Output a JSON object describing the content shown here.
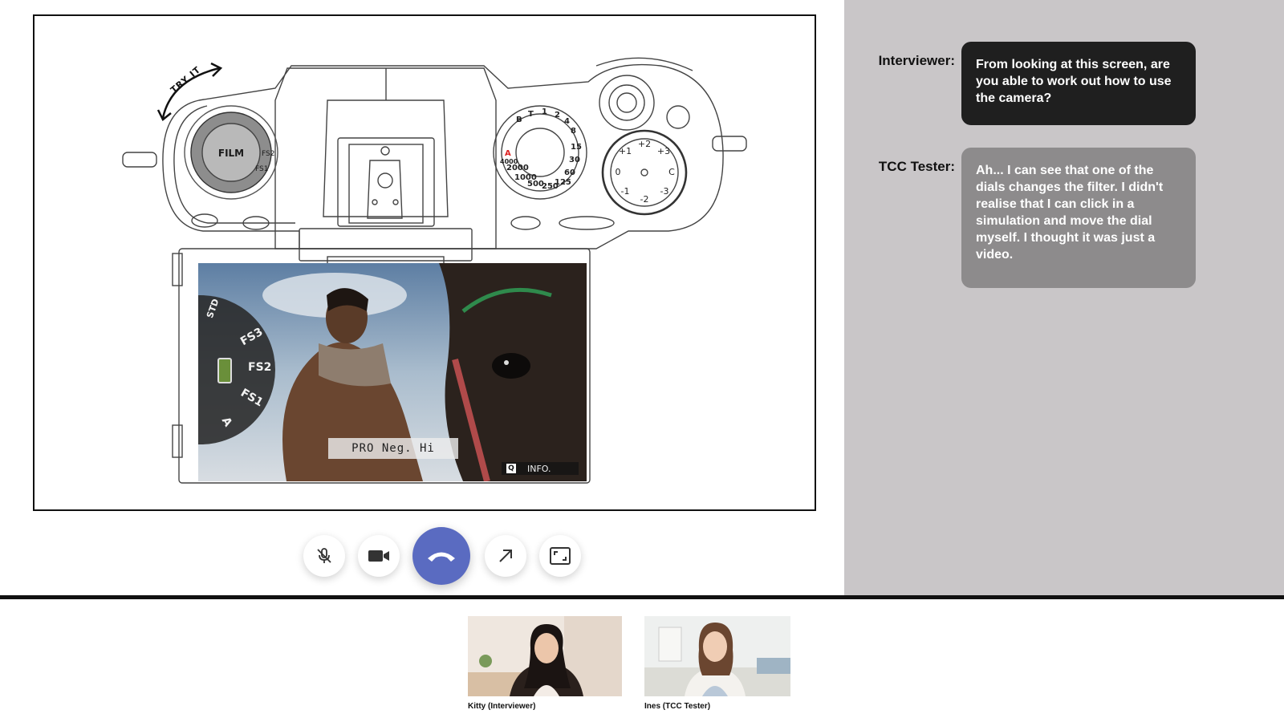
{
  "stage": {
    "try_it_label": "TRY IT",
    "film_dial": {
      "center_label": "FILM",
      "marks": [
        "FS2",
        "FS1"
      ]
    },
    "film_overlay": {
      "labels": [
        "STD",
        "FS3",
        "FS2",
        "FS1",
        "A"
      ]
    },
    "film_sim_caption": "PRO Neg. Hi",
    "info_key": "Q",
    "info_label": "INFO.",
    "shutter_dial_marks": [
      "A",
      "B",
      "T",
      "1",
      "2",
      "4",
      "8",
      "15",
      "30",
      "60",
      "125",
      "250",
      "500",
      "1000",
      "2000",
      "4000"
    ],
    "ev_dial_marks": [
      "0",
      "+1",
      "+2",
      "+3",
      "C",
      "-3",
      "-2",
      "-1"
    ]
  },
  "controls": {
    "mute_icon": "mic-off-icon",
    "video_icon": "video-camera-icon",
    "end_call_icon": "phone-hangup-icon",
    "share_icon": "arrow-up-right-icon",
    "fullscreen_icon": "fullscreen-icon",
    "end_call_color": "#5a6bc1"
  },
  "chat": {
    "messages": [
      {
        "speaker": "Interviewer:",
        "text": "From looking at this screen, are you able to work out how to use the camera?",
        "color": "#1f1f1f"
      },
      {
        "speaker": "TCC Tester:",
        "text": "Ah... I can see that one of the dials changes the filter. I didn't realise that I can click in a simulation and move the dial myself. I thought it was just a video.",
        "color": "#8d8b8c"
      }
    ]
  },
  "participants": [
    {
      "name": "Kitty (Interviewer)"
    },
    {
      "name": "Ines (TCC Tester)"
    }
  ]
}
